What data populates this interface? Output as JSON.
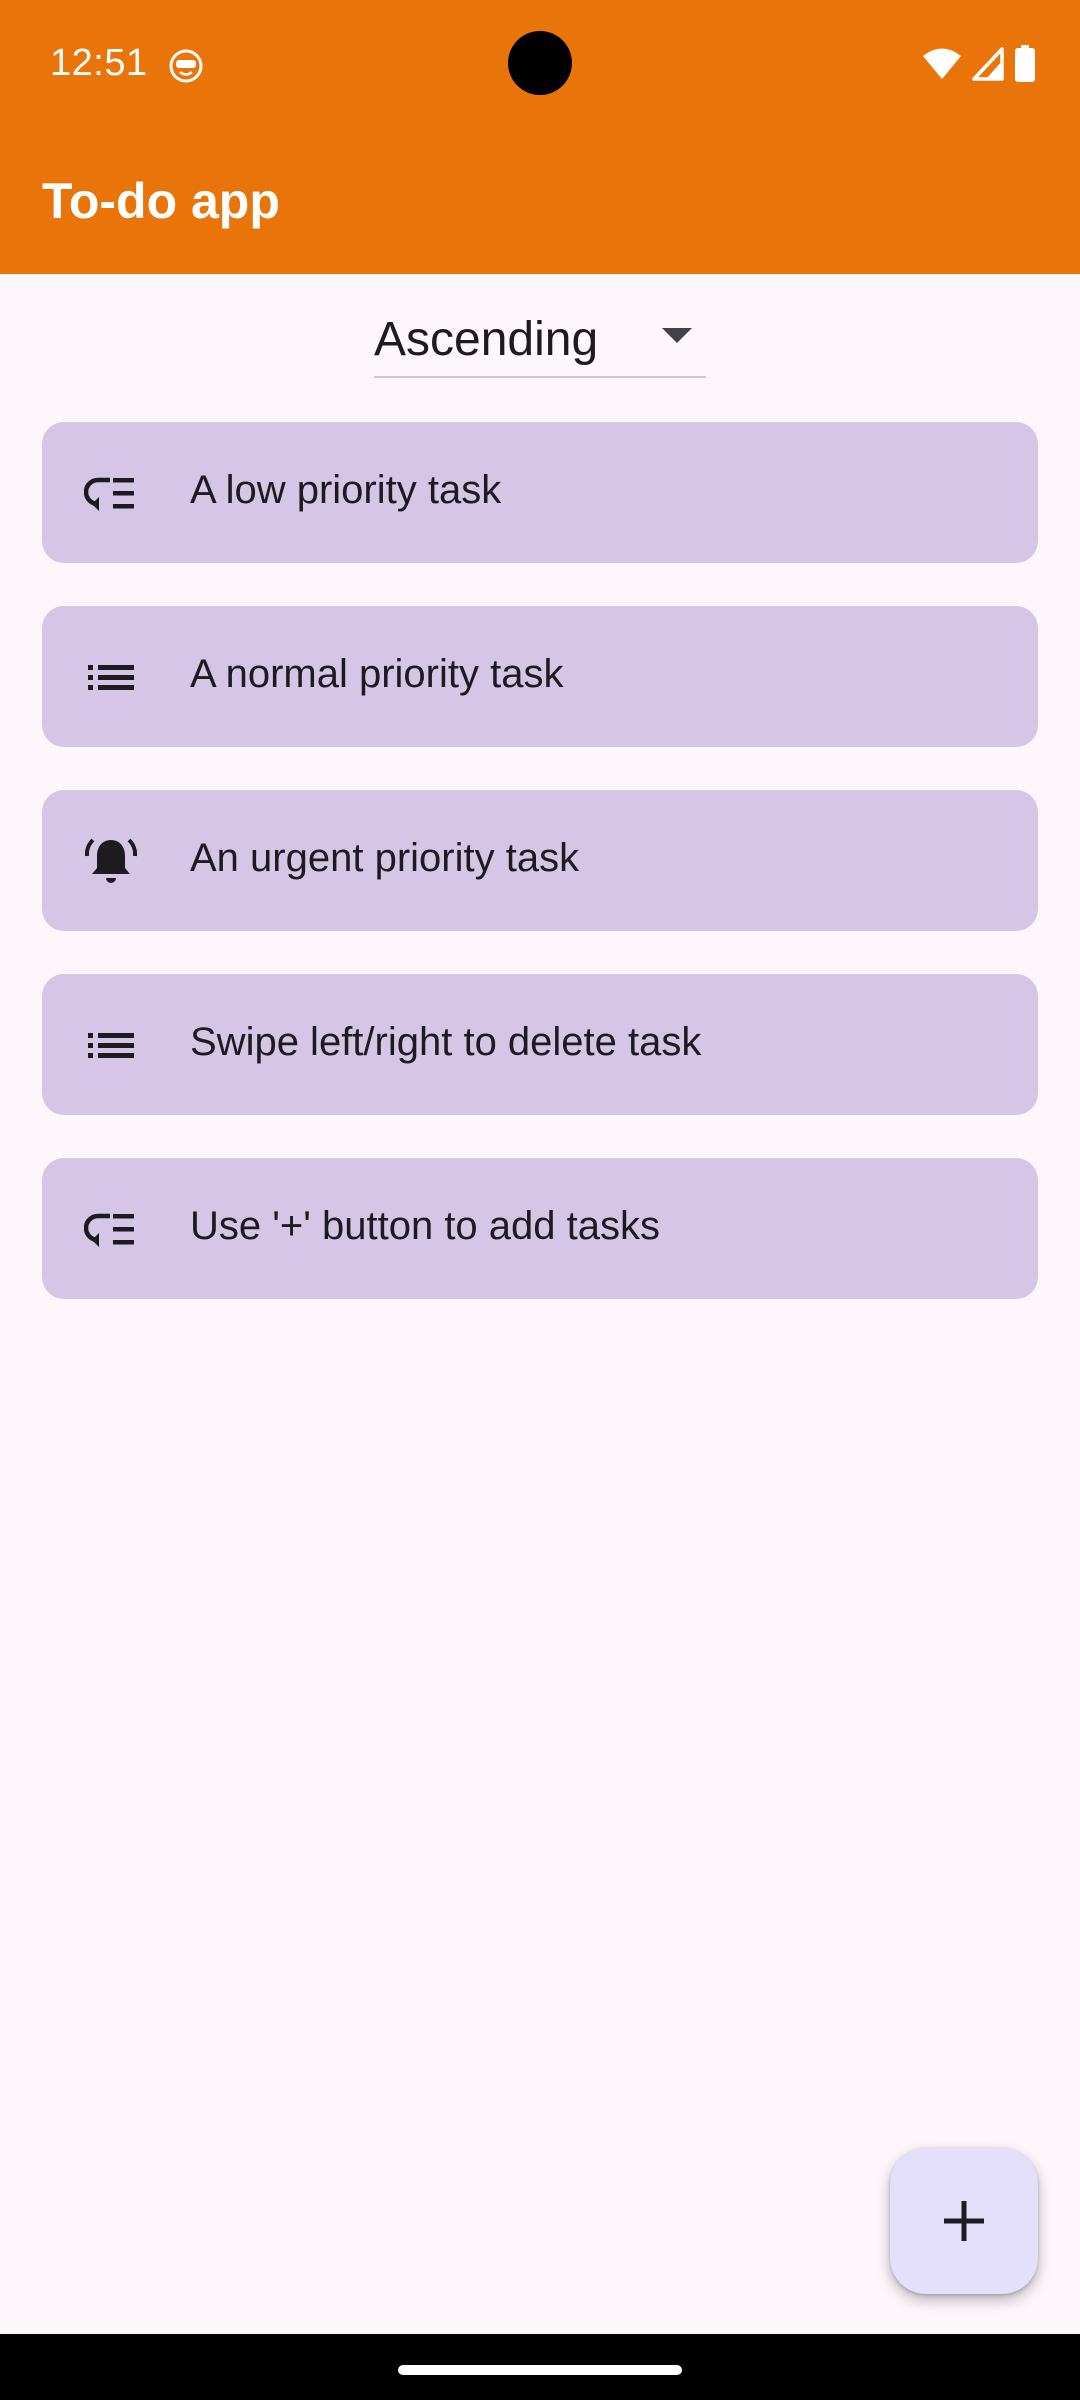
{
  "status_bar": {
    "time": "12:51",
    "icons": [
      "face-notification-icon",
      "wifi-icon",
      "signal-icon",
      "battery-icon"
    ],
    "background_color": "#E97409"
  },
  "app_bar": {
    "title": "To-do app",
    "background_color": "#E97409"
  },
  "sort": {
    "selected": "Ascending",
    "icon": "arrow-drop-down-icon"
  },
  "tasks": [
    {
      "label": "A low priority task",
      "icon": "low-priority-icon"
    },
    {
      "label": "A normal priority task",
      "icon": "list-icon"
    },
    {
      "label": "An urgent priority task",
      "icon": "alarm-bell-icon"
    },
    {
      "label": "Swipe left/right to delete task",
      "icon": "list-icon"
    },
    {
      "label": "Use '+' button to add tasks",
      "icon": "low-priority-icon"
    }
  ],
  "fab": {
    "icon": "add-icon",
    "background_color": "#E4DFFA"
  },
  "colors": {
    "card": "#D5C6E7",
    "page_background": "#FDF7FC"
  }
}
